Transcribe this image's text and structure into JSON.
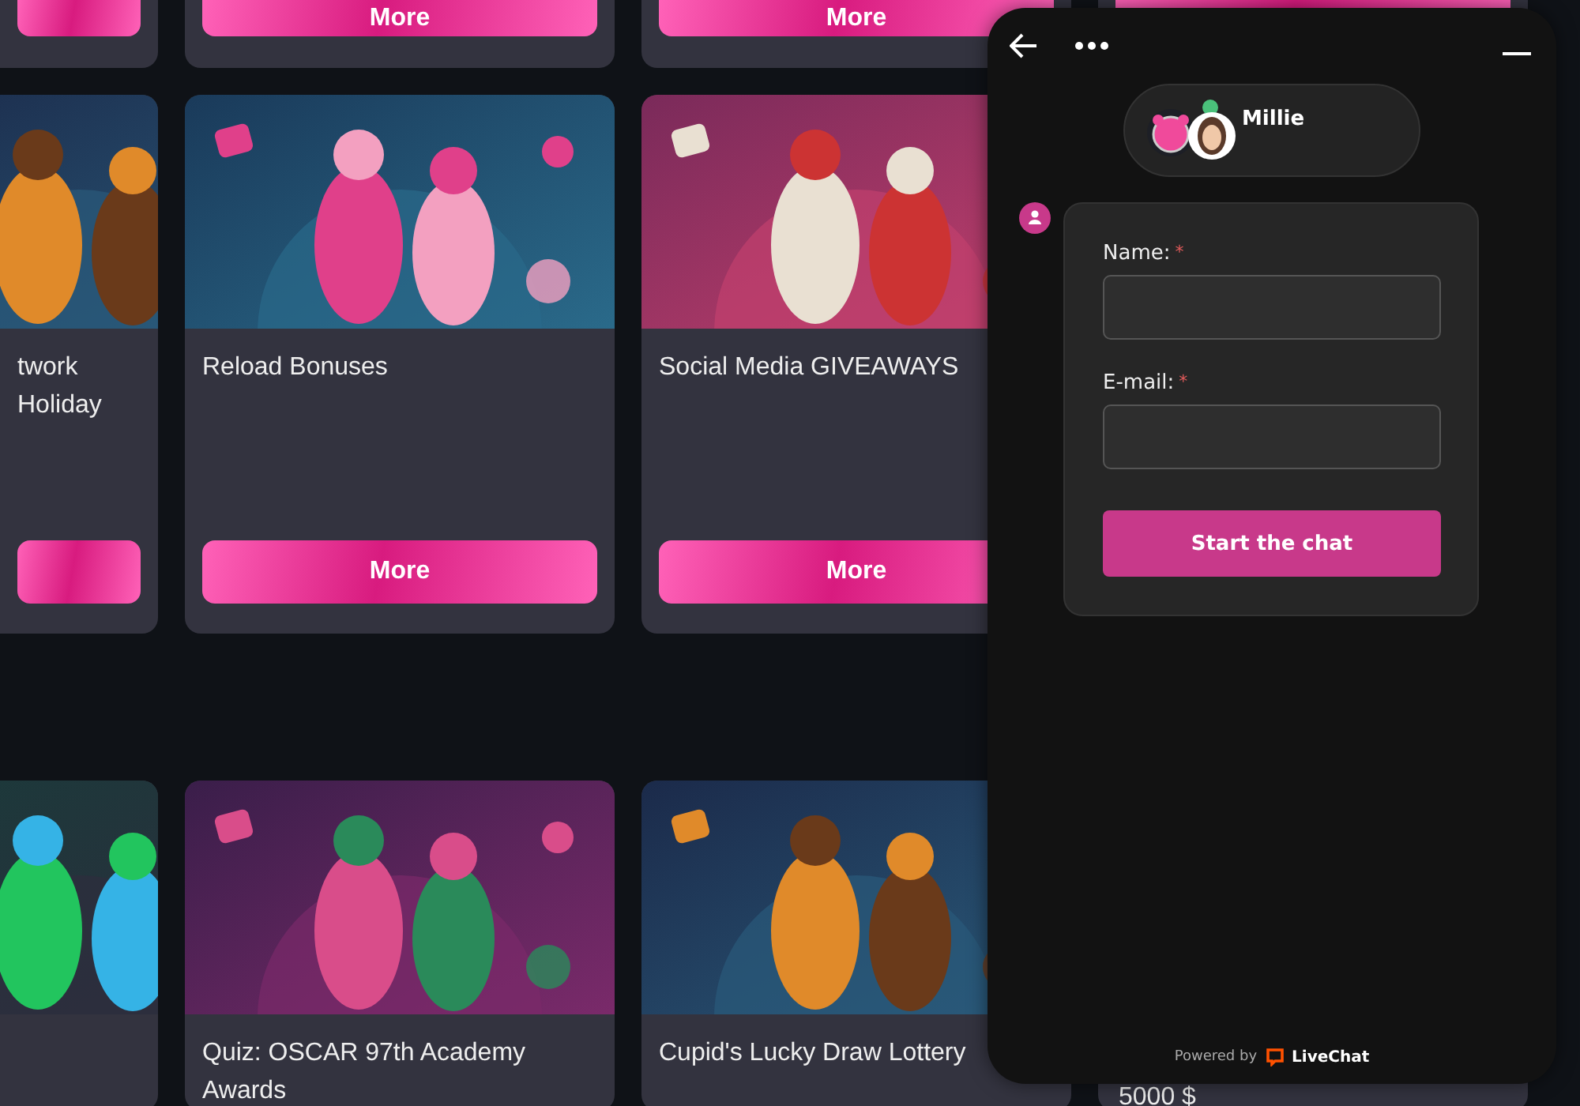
{
  "promo_grid": {
    "rows": [
      {
        "cards": [
          {
            "kind": "stub"
          },
          {
            "kind": "stub",
            "button": "More"
          },
          {
            "kind": "stub",
            "button": "More"
          },
          {
            "kind": "stub"
          }
        ]
      },
      {
        "cards": [
          {
            "kind": "promo",
            "title": "twork Holiday"
          },
          {
            "kind": "promo",
            "title": "Reload Bonuses",
            "button": "More"
          },
          {
            "kind": "promo",
            "title": "Social Media GIVEAWAYS",
            "button": "More"
          },
          {
            "kind": "blank"
          }
        ]
      },
      {
        "cards": [
          {
            "kind": "promo"
          },
          {
            "kind": "promo",
            "title": "Quiz: OSCAR 97th Academy Awards"
          },
          {
            "kind": "promo",
            "title": "Cupid's Lucky Draw Lottery"
          },
          {
            "kind": "amount",
            "amount": "5000 $"
          }
        ]
      }
    ]
  },
  "chat": {
    "agent": {
      "name": "Millie",
      "online": true
    },
    "form": {
      "fields": [
        {
          "label": "Name:",
          "marker": "*"
        },
        {
          "label": "E-mail:",
          "marker": "*"
        }
      ],
      "submit": "Start the chat"
    },
    "footer": {
      "powered_by": "Powered by",
      "brand": "LiveChat"
    }
  }
}
